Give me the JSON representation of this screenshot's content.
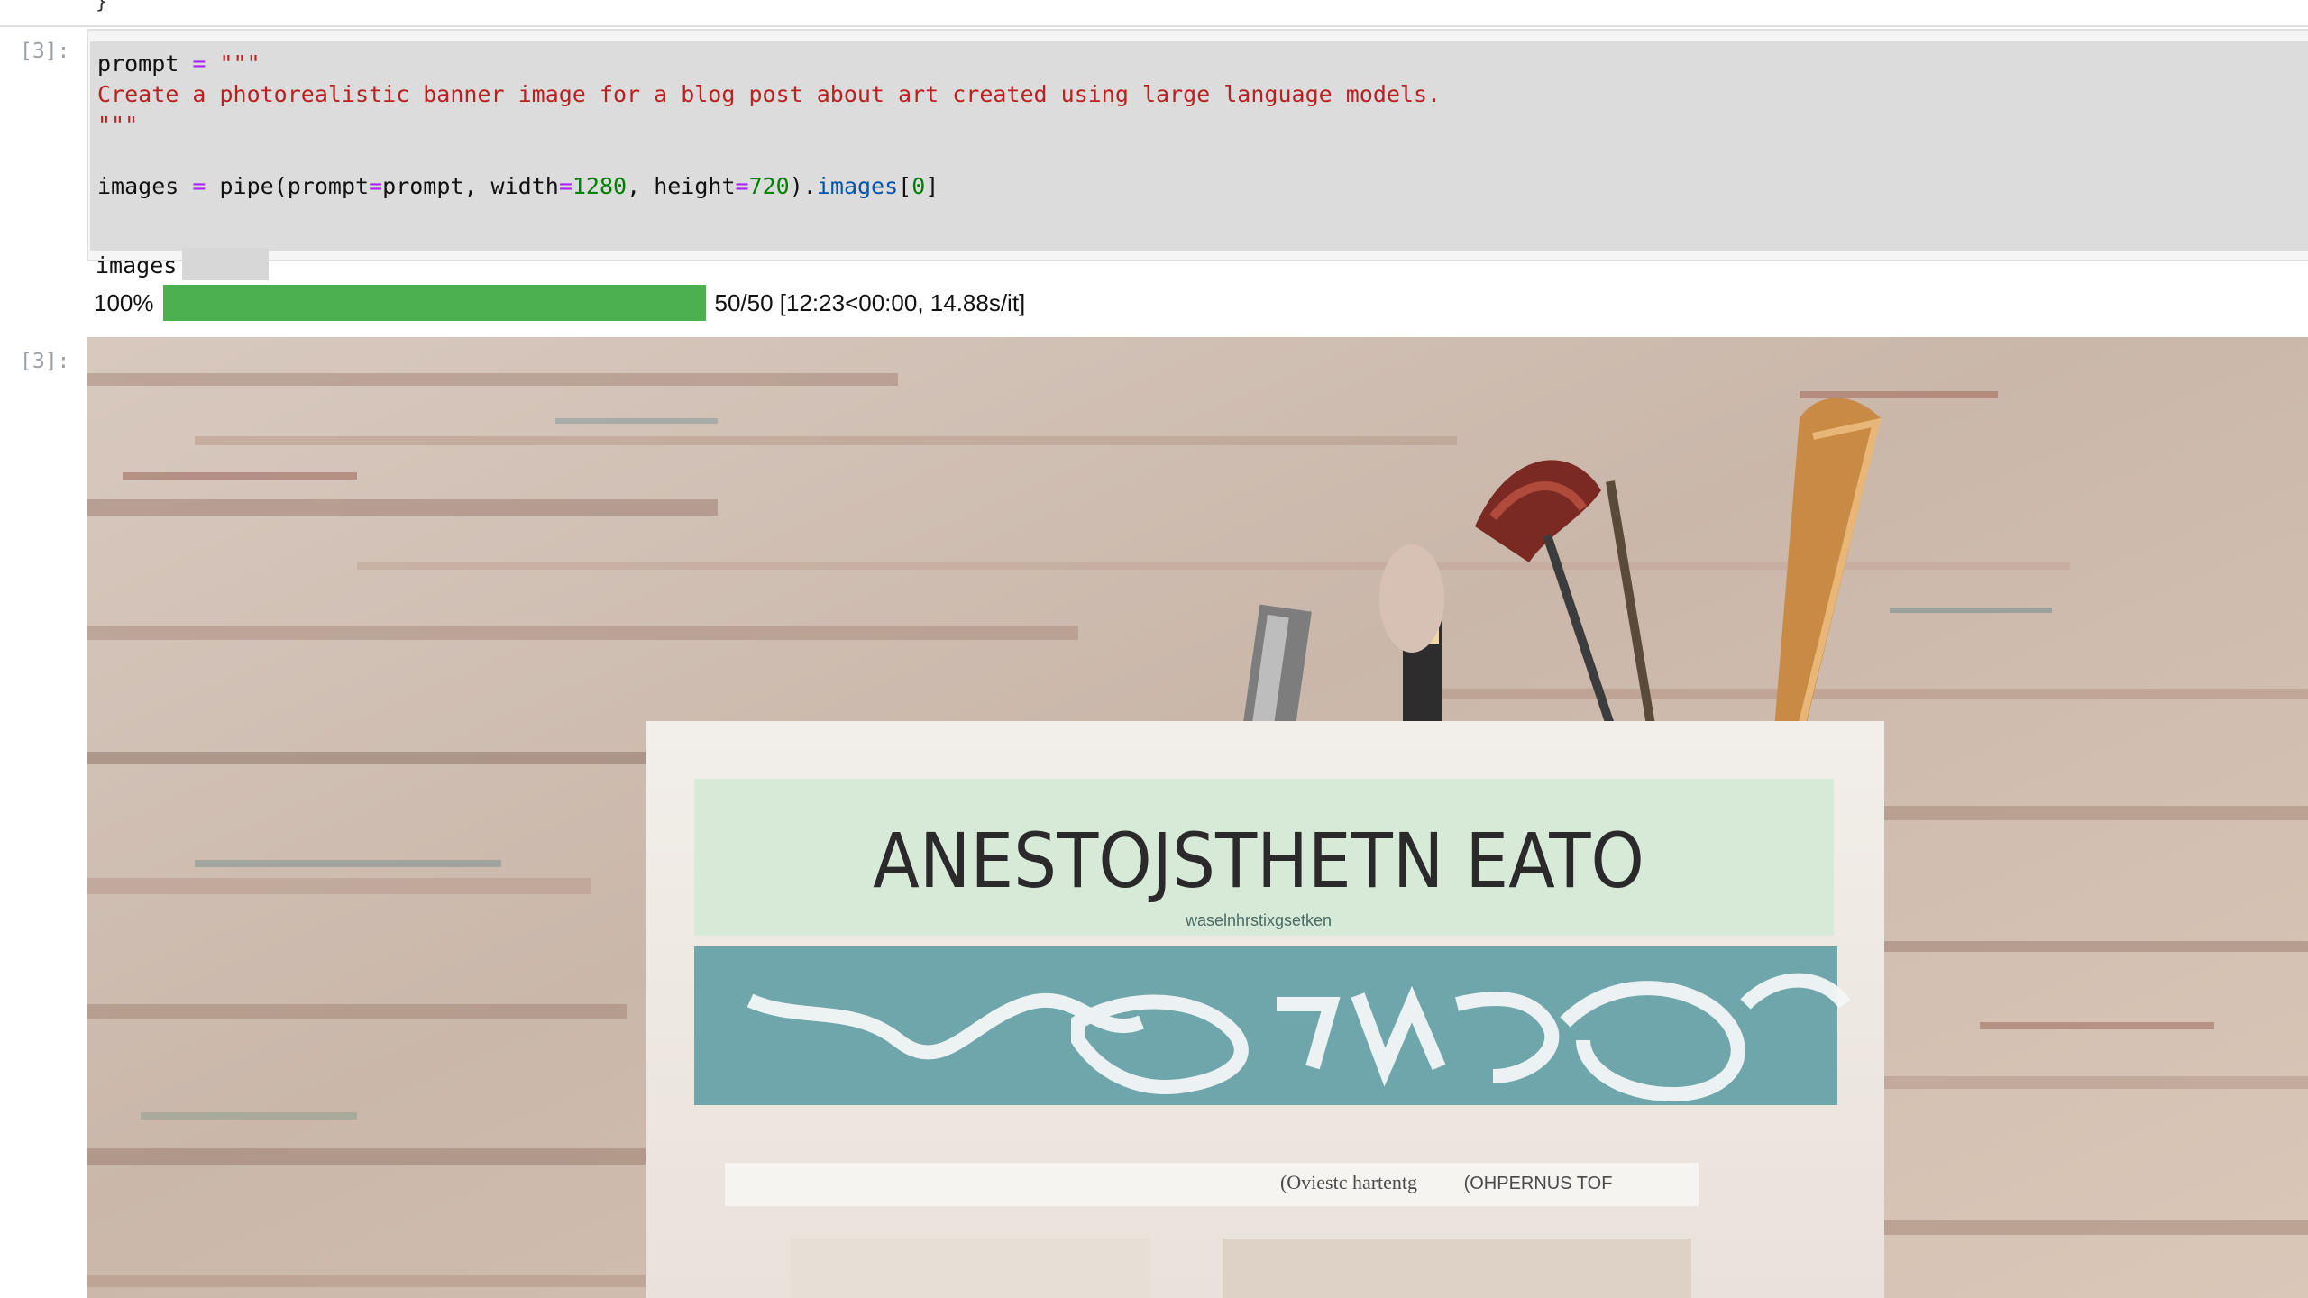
{
  "notebook": {
    "top_glyph": "}",
    "input_prompt": "[3]:",
    "output_prompt": "[3]:",
    "code_lines": {
      "line1_name": "prompt",
      "line1_op": "=",
      "line1_str": "\"\"\"",
      "line2_str": "Create a photorealistic banner image for a blog post about art created using large language models.",
      "line3_str": "\"\"\"",
      "line4_var": "images",
      "line4_eq": "=",
      "line4_call": "pipe(prompt",
      "line4_kw1_eq": "=",
      "line4_after_kw1": "prompt, width",
      "line4_kw2_eq": "=",
      "line4_width": "1280",
      "line4_mid": ", height",
      "line4_kw3_eq": "=",
      "line4_height": "720",
      "line4_close": ").",
      "line4_attr": "images",
      "line4_index_open": "[",
      "line4_index": "0",
      "line4_index_close": "]",
      "line5_expr": "images"
    },
    "progress": {
      "percent_label": "100%",
      "fraction": 1.0,
      "status_text": "50/50 [12:23<00:00, 14.88s/it]",
      "bar_color": "#4caf50"
    },
    "image": {
      "banner_title": "ANESTOJSTHETN EATO",
      "small_line": "waselnhrstixgsetken",
      "bottom_left_text": "(Oviestc hartentg",
      "bottom_right_text": "(OHPERNUS TOF",
      "accent_green": "#d7ead7",
      "accent_teal": "#6fa6ab",
      "paper": "#f0ece6"
    }
  }
}
